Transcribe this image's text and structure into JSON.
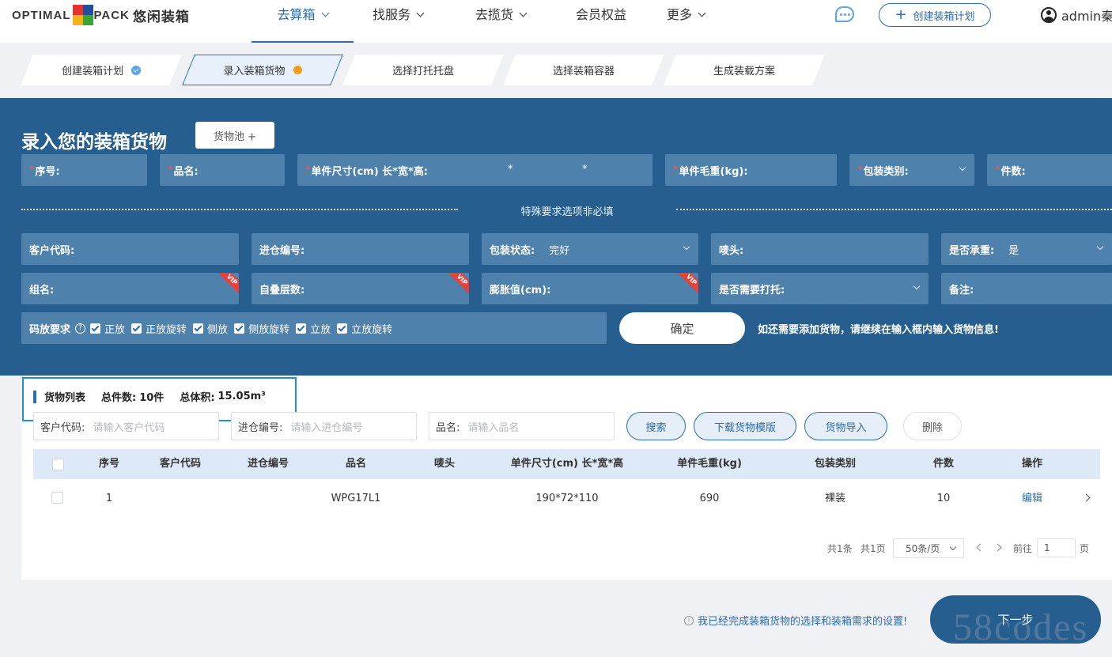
{
  "brand": {
    "logo_text_left": "OPTIMAL",
    "logo_text_right": "PACK",
    "logo_cn": "悠闲装箱",
    "logo_colors": [
      "#e5322d",
      "#1f4e9a",
      "#f5b21a",
      "#3aa535"
    ]
  },
  "nav": {
    "items": [
      {
        "label": "去算箱",
        "dropdown": true,
        "active": true
      },
      {
        "label": "找服务",
        "dropdown": true
      },
      {
        "label": "去揽货",
        "dropdown": true
      },
      {
        "label": "会员权益",
        "dropdown": false
      },
      {
        "label": "更多",
        "dropdown": true
      }
    ],
    "chat_icon": "chat-bubble-icon",
    "create_label": "创建装箱计划",
    "user": "admin秦"
  },
  "steps": [
    {
      "label": "创建装箱计划",
      "status": "done"
    },
    {
      "label": "录入装箱货物",
      "status": "current"
    },
    {
      "label": "选择打托托盘",
      "status": "pending"
    },
    {
      "label": "选择装箱容器",
      "status": "pending"
    },
    {
      "label": "生成装载方案",
      "status": "pending"
    }
  ],
  "form": {
    "title": "录入您的装箱货物",
    "pool_button": "货物池 +",
    "required_fields": {
      "seq": "序号:",
      "name": "品名:",
      "size": "单件尺寸(cm) 长*宽*高:",
      "size_sep": "*",
      "weight": "单件毛重(kg):",
      "pack_type": "包装类别:",
      "qty": "件数:"
    },
    "required_mark": "*",
    "optional_title": "特殊要求选项非必填",
    "optional": {
      "customer_code": "客户代码:",
      "inbound_no": "进仓编号:",
      "pack_state_label": "包装状态:",
      "pack_state_value": "完好",
      "mark": "唛头:",
      "load_bearing_label": "是否承重:",
      "load_bearing_value": "是",
      "group_name": "组名:",
      "stack_layers": "自叠层数:",
      "expansion": "膨胀值(cm):",
      "need_pallet": "是否需要打托:",
      "remark": "备注:"
    },
    "vip_badge": "VIP",
    "stacking": {
      "label": "码放要求",
      "help": "?",
      "options": [
        "正放",
        "正放旋转",
        "侧放",
        "侧放旋转",
        "立放",
        "立放旋转"
      ]
    },
    "confirm_button": "确定",
    "hint": "如还需要添加货物，请继续在输入框内输入货物信息!"
  },
  "list": {
    "title": "货物列表",
    "total_qty_label": "总件数:",
    "total_qty": "10件",
    "total_vol_label": "总体积:",
    "total_vol": "15.05m³",
    "search": [
      {
        "label": "客户代码:",
        "placeholder": "请输入客户代码"
      },
      {
        "label": "进仓编号:",
        "placeholder": "请输入进仓编号"
      },
      {
        "label": "品名:",
        "placeholder": "请输入品名"
      }
    ],
    "buttons": {
      "search": "搜索",
      "download": "下载货物模版",
      "import": "货物导入",
      "delete": "删除"
    },
    "columns": [
      "序号",
      "客户代码",
      "进仓编号",
      "品名",
      "唛头",
      "单件尺寸(cm) 长*宽*高",
      "单件毛重(kg)",
      "包装类别",
      "件数",
      "操作"
    ],
    "rows": [
      {
        "seq": "1",
        "customer": "",
        "inbound": "",
        "name": "WPG17L1",
        "mark": "",
        "size": "190*72*110",
        "weight": "690",
        "pack": "裸装",
        "qty": "10",
        "action": "编辑"
      }
    ],
    "pager": {
      "total": "共1条",
      "pages": "共1页",
      "page_size": "50条/页",
      "goto": "前往",
      "page": "1",
      "page_unit": "页"
    }
  },
  "footer": {
    "info_icon": "i",
    "note": "我已经完成装箱货物的选择和装箱需求的设置!",
    "next": "下一步",
    "watermark": "58codes"
  }
}
